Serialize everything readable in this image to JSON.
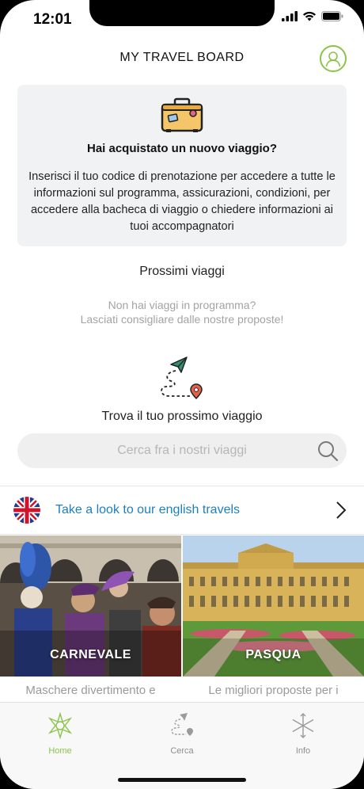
{
  "status_bar": {
    "time": "12:01"
  },
  "header": {
    "title": "MY TRAVEL BOARD"
  },
  "info_card": {
    "title": "Hai acquistato un nuovo viaggio?",
    "text": "Inserisci il tuo codice di prenotazione per accedere a tutte le informazioni sul programma, assicurazioni, condizioni, per accedere alla bacheca di viaggio o chiedere informazioni ai tuoi accompagnatori"
  },
  "upcoming": {
    "title": "Prossimi viaggi",
    "empty_line1": "Non hai viaggi in programma?",
    "empty_line2": "Lasciati consigliare dalle nostre proposte!"
  },
  "finder": {
    "title": "Trova il tuo prossimo viaggio",
    "search_placeholder": "Cerca fra i nostri viaggi"
  },
  "english_row": {
    "label": "Take a look to our english travels"
  },
  "tiles": [
    {
      "label": "CARNEVALE",
      "desc": "Maschere divertimento e"
    },
    {
      "label": "PASQUA",
      "desc": "Le migliori proposte per i"
    }
  ],
  "tab_bar": {
    "items": [
      {
        "label": "Home",
        "icon": "home-star-icon"
      },
      {
        "label": "Cerca",
        "icon": "route-icon"
      },
      {
        "label": "Info",
        "icon": "info-star-icon"
      }
    ]
  },
  "colors": {
    "accent": "#8bc34a",
    "link": "#1e7fbf",
    "card_bg": "#f1f2f4"
  }
}
